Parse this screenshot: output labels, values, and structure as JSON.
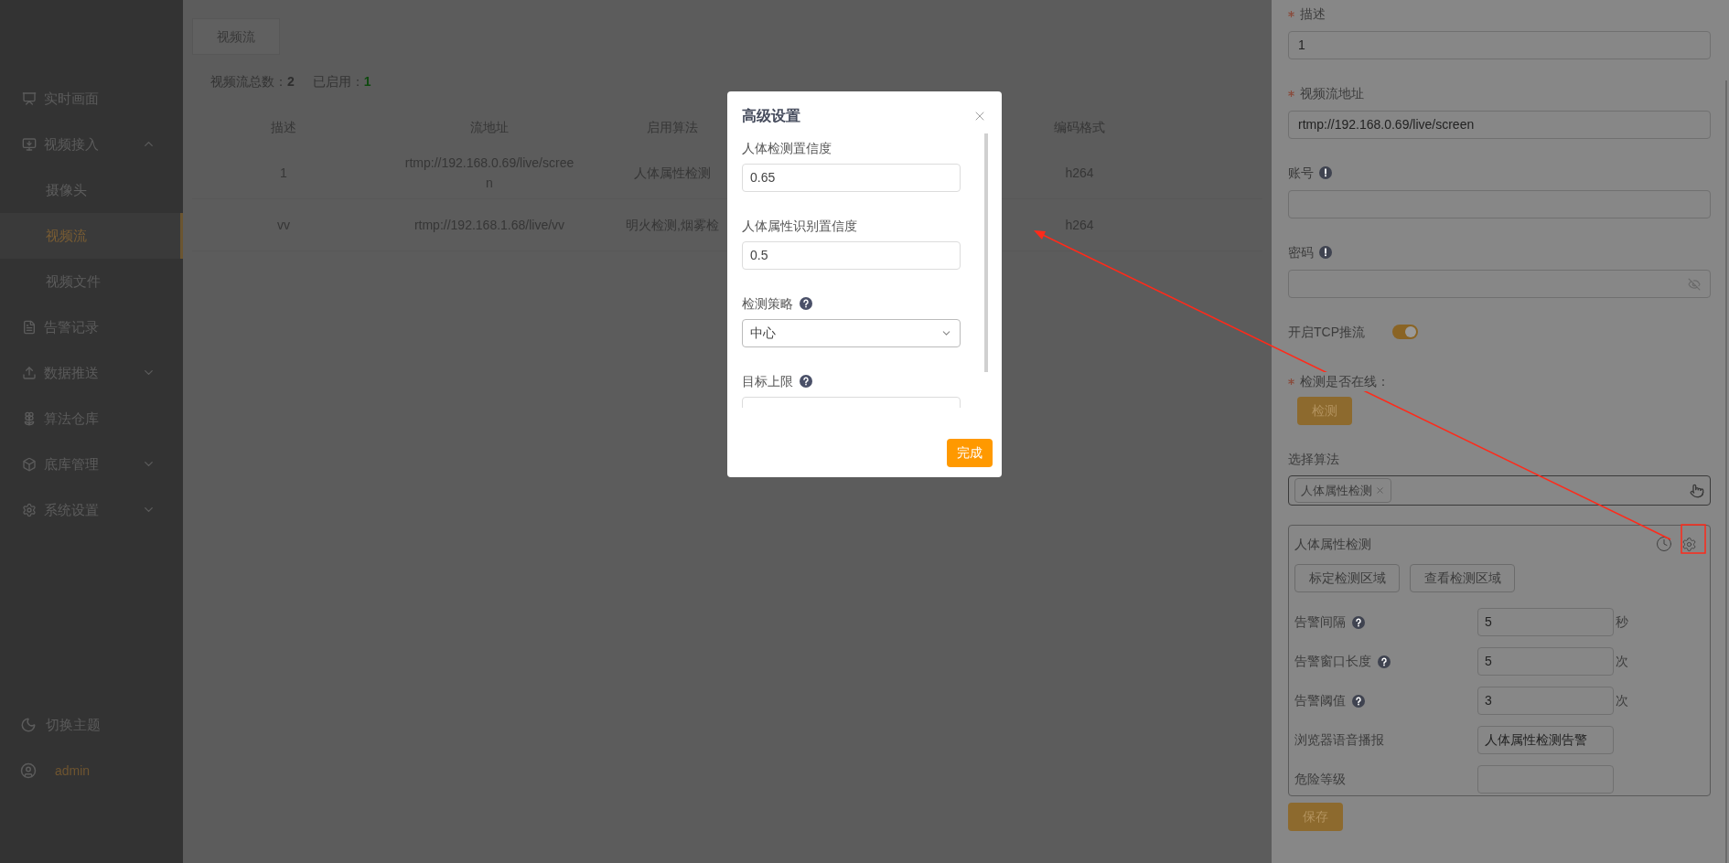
{
  "sidebar": {
    "items": [
      {
        "label": "实时画面",
        "selected": false
      },
      {
        "label": "视频接入",
        "selected": false,
        "expanded": true,
        "children": [
          {
            "label": "摄像头",
            "selected": false
          },
          {
            "label": "视频流",
            "selected": true
          },
          {
            "label": "视频文件",
            "selected": false
          }
        ]
      },
      {
        "label": "告警记录",
        "selected": false
      },
      {
        "label": "数据推送",
        "selected": false,
        "expanded": false
      },
      {
        "label": "算法仓库",
        "selected": false
      },
      {
        "label": "底库管理",
        "selected": false,
        "expanded": false
      },
      {
        "label": "系统设置",
        "selected": false,
        "expanded": false
      }
    ],
    "theme": "切换主题",
    "user": "admin"
  },
  "tabs": [
    {
      "label": "视频流",
      "selected": true
    }
  ],
  "stats": [
    {
      "label": "视频流总数：",
      "value": "2",
      "color": "#2e2e2e"
    },
    {
      "label": "已启用：",
      "value": "1",
      "color": "#0f4a0f"
    }
  ],
  "table": {
    "columns": [
      "描述",
      "流地址",
      "启用算法",
      "编码格式"
    ],
    "rows": [
      [
        "1",
        "rtmp://192.168.0.69/live/screen",
        "人体属性检测",
        "h264"
      ],
      [
        "vv",
        "rtmp://192.168.1.68/live/vv",
        "明火检测,烟雾检",
        "h264"
      ]
    ]
  },
  "drawer": {
    "fields": [
      {
        "kind": "text",
        "label": "描述",
        "required": true,
        "notice": false,
        "value": "1"
      },
      {
        "kind": "text",
        "label": "视频流地址",
        "required": true,
        "notice": false,
        "value": "rtmp://192.168.0.69/live/screen"
      },
      {
        "kind": "text",
        "label": "账号",
        "required": false,
        "notice": true
      },
      {
        "kind": "password",
        "label": "密码",
        "required": false,
        "notice": true
      },
      {
        "kind": "switch",
        "label": "开启TCP推流",
        "required": false,
        "notice": false,
        "on": true
      },
      {
        "kind": "button",
        "label": "检测是否在线：",
        "required": true,
        "notice": false,
        "button": "检测"
      },
      {
        "kind": "tags",
        "label": "选择算法",
        "required": false,
        "notice": false,
        "tags": [
          "人体属性检测"
        ]
      }
    ],
    "card": {
      "title": "人体属性检测",
      "buttons": [
        "标定检测区域",
        "查看检测区域"
      ],
      "rows": [
        {
          "label": "告警间隔",
          "help": true,
          "value": "5",
          "unit": "秒"
        },
        {
          "label": "告警窗口长度",
          "help": true,
          "value": "5",
          "unit": "次"
        },
        {
          "label": "告警阈值",
          "help": true,
          "value": "3",
          "unit": "次"
        },
        {
          "label": "浏览器语音播报",
          "help": false,
          "value": "人体属性检测告警"
        },
        {
          "label": "危险等级",
          "help": false
        }
      ]
    },
    "save": "保存"
  },
  "modal": {
    "title": "高级设置",
    "fields": [
      {
        "kind": "input",
        "label": "人体检测置信度",
        "help": false,
        "value": "0.65"
      },
      {
        "kind": "input",
        "label": "人体属性识别置信度",
        "help": false,
        "value": "0.5"
      },
      {
        "kind": "select",
        "label": "检测策略",
        "help": true,
        "value": "中心"
      },
      {
        "kind": "input",
        "label": "目标上限",
        "help": true
      }
    ],
    "confirm": "完成"
  }
}
